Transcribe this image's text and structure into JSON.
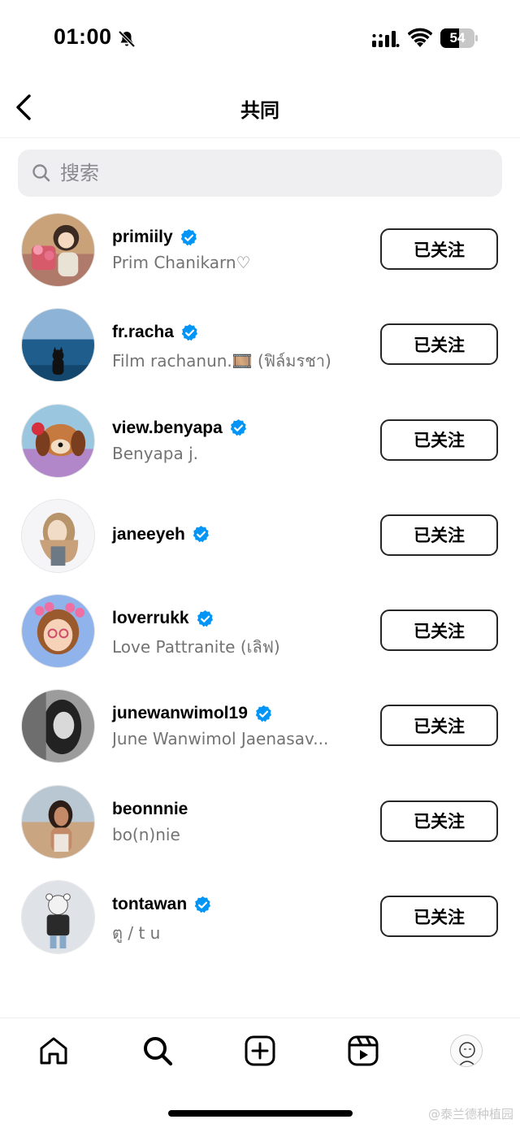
{
  "status_bar": {
    "time": "01:00",
    "battery": "54"
  },
  "header": {
    "title": "共同"
  },
  "search": {
    "placeholder": "搜索"
  },
  "users": [
    {
      "username": "primiily",
      "full_name": "Prim Chanikarn♡",
      "verified": true,
      "button": "已关注"
    },
    {
      "username": "fr.racha",
      "full_name": "Film rachanun.🎞️ (ฟิล์มรชา)",
      "verified": true,
      "button": "已关注"
    },
    {
      "username": "view.benyapa",
      "full_name": "Benyapa j.",
      "verified": true,
      "button": "已关注"
    },
    {
      "username": "janeeyeh",
      "full_name": "",
      "verified": true,
      "button": "已关注"
    },
    {
      "username": "loverrukk",
      "full_name": "Love Pattranite (เลิฟ)",
      "verified": true,
      "button": "已关注"
    },
    {
      "username": "junewanwimol19",
      "full_name": "June Wanwimol Jaenasav...",
      "verified": true,
      "button": "已关注"
    },
    {
      "username": "beonnnie",
      "full_name": "bo(n)nie",
      "verified": false,
      "button": "已关注"
    },
    {
      "username": "tontawan",
      "full_name": "ตู / t u",
      "verified": true,
      "button": "已关注"
    }
  ],
  "tab_bar": {
    "items": [
      "home-icon",
      "search-icon",
      "create-icon",
      "reels-icon",
      "profile-avatar"
    ]
  },
  "watermark": "@泰兰德种植园",
  "colors": {
    "verified": "#0095f6",
    "secondary_text": "#737373",
    "search_bg": "#efeff1"
  }
}
